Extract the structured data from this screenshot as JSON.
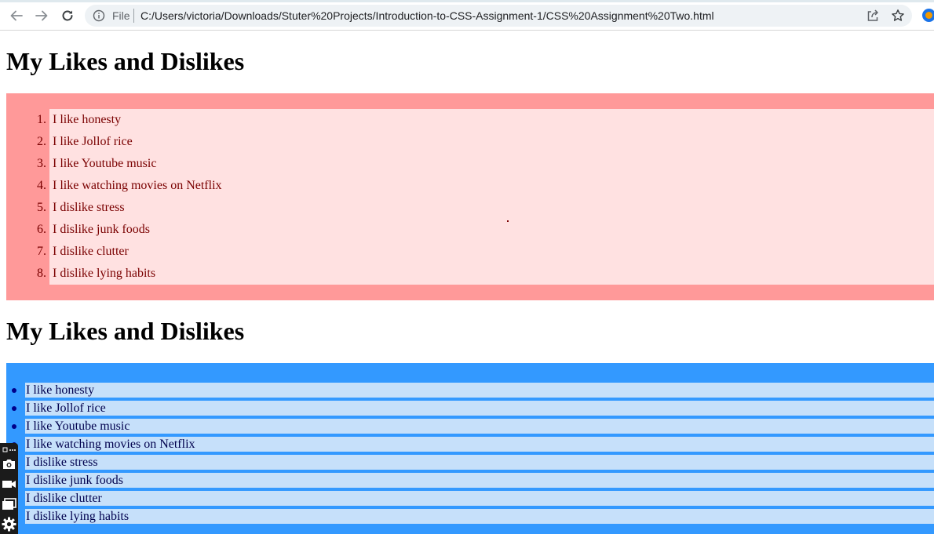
{
  "browser": {
    "scheme_label": "File",
    "url": "C:/Users/victoria/Downloads/Stuter%20Projects/Introduction-to-CSS-Assignment-1/CSS%20Assignment%20Two.html"
  },
  "colors": {
    "ordered_outer": "#ff9999",
    "ordered_inner": "#ffe1e1",
    "ordered_text": "#7a0000",
    "unordered_outer": "#3399ff",
    "unordered_inner": "#c6e0fa",
    "unordered_text": "#00004d"
  },
  "section1": {
    "heading": "My Likes and Dislikes",
    "items": [
      {
        "num": "1.",
        "text": "I like honesty"
      },
      {
        "num": "2.",
        "text": "I like Jollof rice"
      },
      {
        "num": "3.",
        "text": "I like Youtube music"
      },
      {
        "num": "4.",
        "text": "I like watching movies on Netflix"
      },
      {
        "num": "5.",
        "text": "I dislike stress"
      },
      {
        "num": "6.",
        "text": "I dislike junk foods"
      },
      {
        "num": "7.",
        "text": "I dislike clutter"
      },
      {
        "num": "8.",
        "text": "I dislike lying habits"
      }
    ]
  },
  "section2": {
    "heading": "My Likes and Dislikes",
    "items": [
      {
        "text": "I like honesty"
      },
      {
        "text": "I like Jollof rice"
      },
      {
        "text": "I like Youtube music"
      },
      {
        "text": "I like watching movies on Netflix"
      },
      {
        "text": "I dislike stress"
      },
      {
        "text": "I dislike junk foods"
      },
      {
        "text": "I dislike clutter"
      },
      {
        "text": "I dislike lying habits"
      }
    ]
  },
  "capture_toolbar": {
    "icons": [
      "more-icon",
      "camera-icon",
      "video-icon",
      "window-icon",
      "gear-icon"
    ]
  }
}
